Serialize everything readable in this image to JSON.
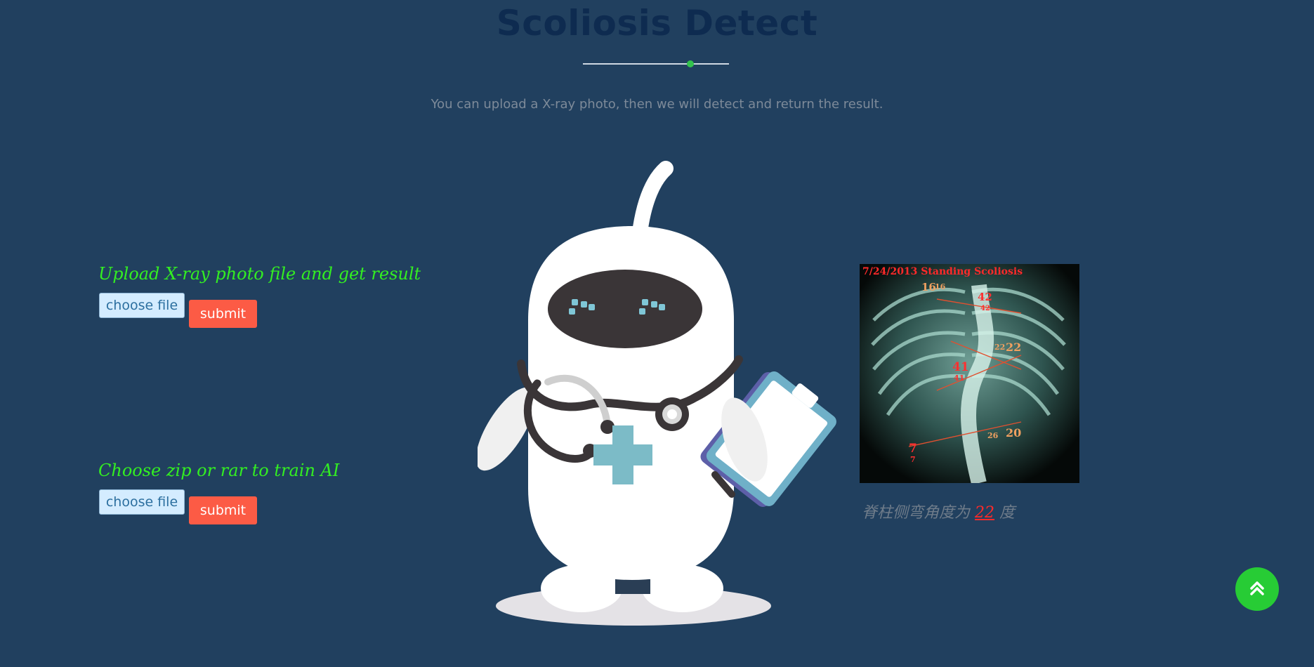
{
  "header": {
    "title": "Scoliosis Detect",
    "subtitle": "You can upload a X-ray photo, then we will detect and return the result.",
    "accent_color": "#33c24d"
  },
  "upload_section": {
    "heading": "Upload X-ray photo file and get result",
    "choose_file_label": "choose file",
    "submit_label": "submit"
  },
  "train_section": {
    "heading": "Choose zip or rar to train AI",
    "choose_file_label": "choose file",
    "submit_label": "submit"
  },
  "result": {
    "image_header_text": "7/24/2013 Standing Scoliosis",
    "image_annotations": [
      "16",
      "16",
      "42",
      "42",
      "22",
      "22",
      "41",
      "41",
      "7",
      "7",
      "26",
      "20"
    ],
    "caption_prefix": "脊柱侧弯角度为",
    "angle_value": "22",
    "caption_suffix": "度"
  },
  "illustration": {
    "icon": "doctor-robot-illustration"
  },
  "back_to_top": {
    "icon": "double-chevron-up-icon",
    "color": "#27cc35"
  },
  "colors": {
    "background": "#21405f",
    "heading_green": "#33ee22",
    "submit_red": "#fc5b45",
    "file_button_blue": "#d4ecff"
  }
}
